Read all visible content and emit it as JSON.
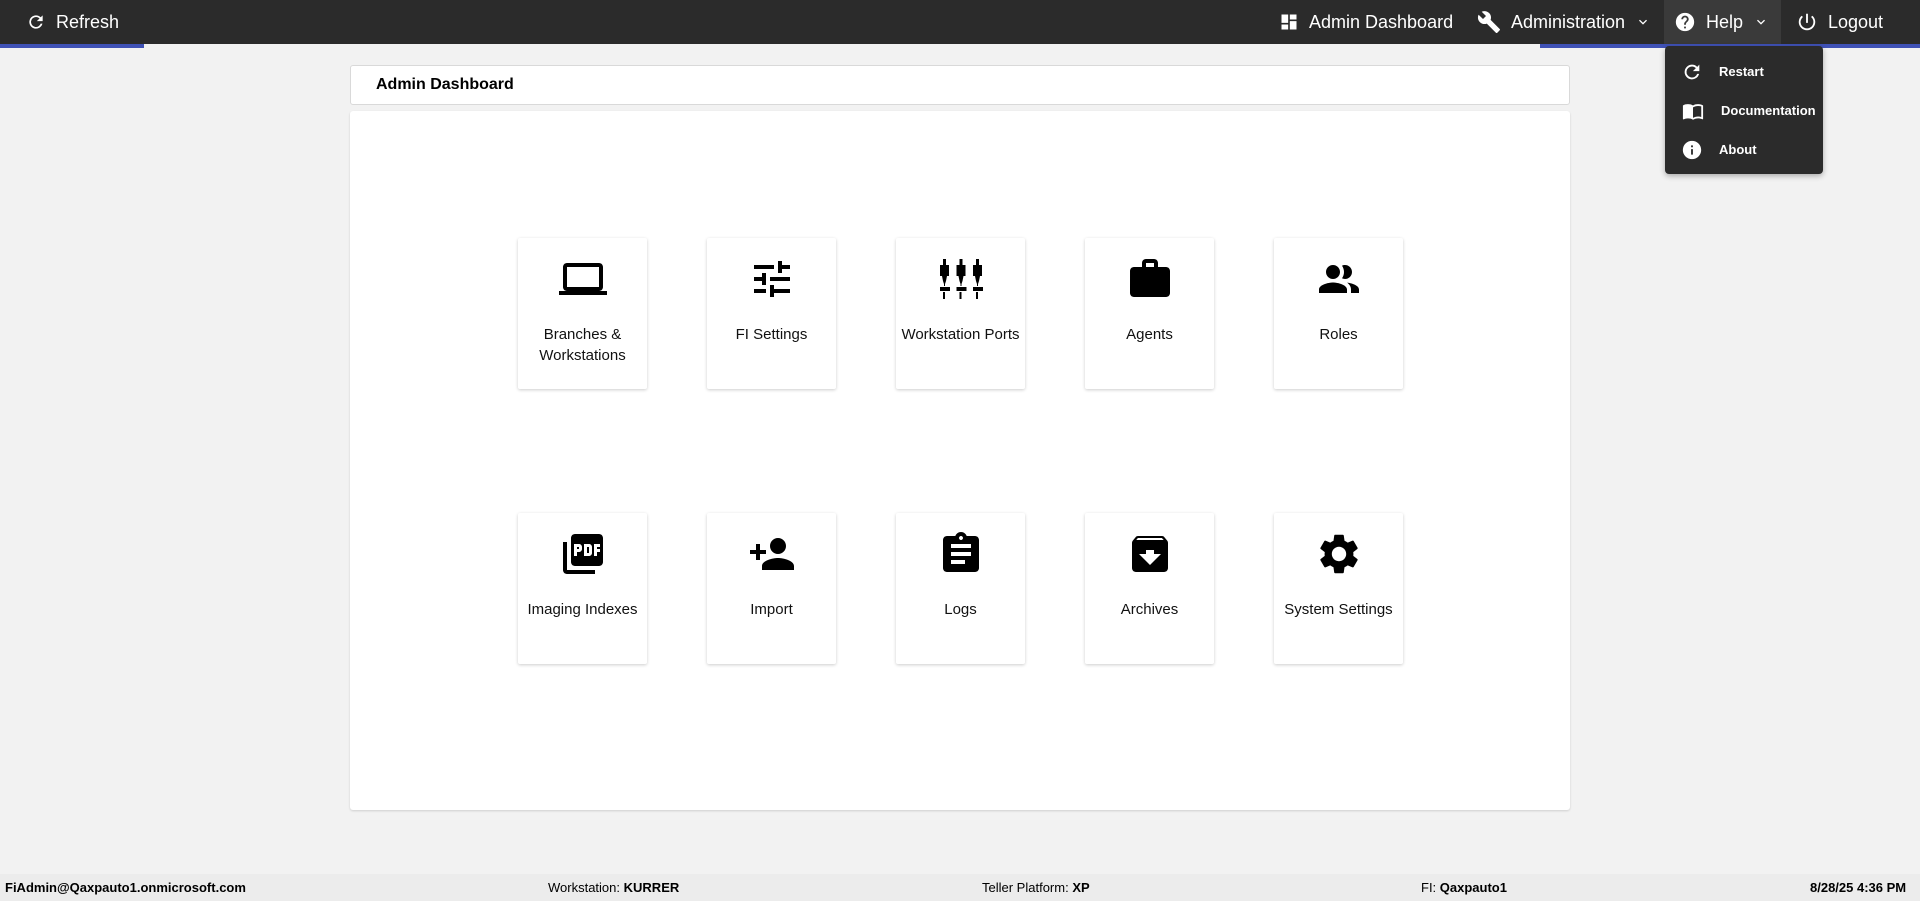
{
  "topbar": {
    "refresh_label": "Refresh",
    "admin_dashboard_label": "Admin Dashboard",
    "administration_label": "Administration",
    "help_label": "Help",
    "logout_label": "Logout"
  },
  "help_menu": {
    "items": [
      {
        "label": "Restart",
        "icon": "restart-icon"
      },
      {
        "label": "Documentation",
        "icon": "book-icon"
      },
      {
        "label": "About",
        "icon": "info-icon"
      }
    ]
  },
  "header": {
    "title": "Admin Dashboard"
  },
  "tiles": [
    {
      "label": "Branches & Workstations",
      "icon": "laptop-icon"
    },
    {
      "label": "FI Settings",
      "icon": "tune-icon"
    },
    {
      "label": "Workstation Ports",
      "icon": "ports-icon"
    },
    {
      "label": "Agents",
      "icon": "briefcase-icon"
    },
    {
      "label": "Roles",
      "icon": "people-icon"
    },
    {
      "label": "Imaging Indexes",
      "icon": "pdf-icon"
    },
    {
      "label": "Import",
      "icon": "person-add-icon"
    },
    {
      "label": "Logs",
      "icon": "clipboard-icon"
    },
    {
      "label": "Archives",
      "icon": "archive-icon"
    },
    {
      "label": "System Settings",
      "icon": "gear-icon"
    }
  ],
  "status": {
    "user": "FiAdmin@Qaxpauto1.onmicrosoft.com",
    "workstation_label": "Workstation:",
    "workstation_value": "KURRER",
    "platform_label": "Teller Platform:",
    "platform_value": "XP",
    "fi_label": "FI:",
    "fi_value": "Qaxpauto1",
    "datetime": "8/28/25 4:36 PM"
  },
  "colors": {
    "topbar": "#2b2b2b",
    "accent": "#3f51b5",
    "background": "#f2f2f2"
  }
}
